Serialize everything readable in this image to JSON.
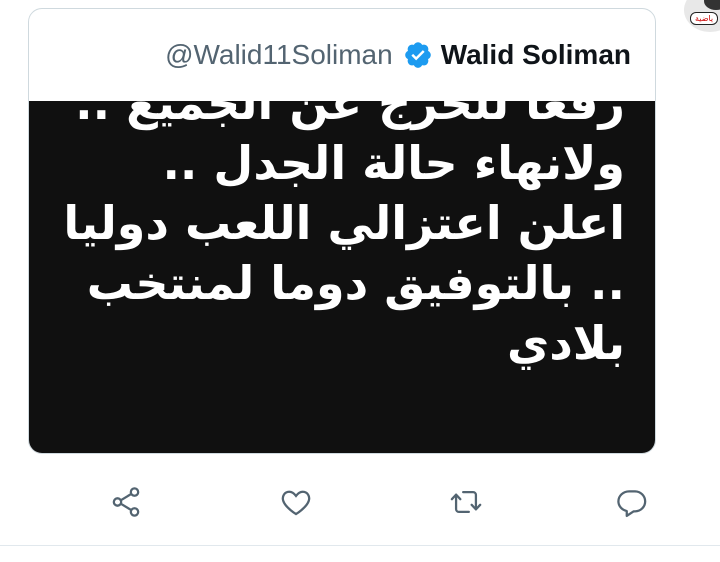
{
  "tweet": {
    "display_name": "Walid Soliman",
    "handle": "@Walid11Soliman",
    "verified": true,
    "image_text_lines": [
      "رفعا للحرج عن الجميع ..",
      "ولانهاء حالة الجدل ..",
      "اعلن اعتزالي اللعب دوليا",
      ".. بالتوفيق دوما لمنتخب",
      "بلادي"
    ]
  },
  "corner_logo": {
    "label": "ياضية"
  },
  "actions": [
    {
      "icon": "share-icon"
    },
    {
      "icon": "heart-icon"
    },
    {
      "icon": "retweet-icon"
    },
    {
      "icon": "reply-icon"
    }
  ],
  "colors": {
    "accent": "#1d9bf0",
    "icon": "#536471",
    "image_bg": "#101010",
    "image_text": "#ffffff"
  }
}
